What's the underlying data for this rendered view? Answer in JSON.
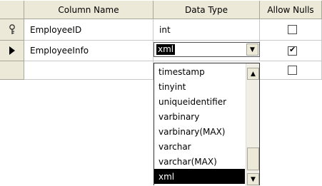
{
  "columns": {
    "name": "Column Name",
    "type": "Data Type",
    "nulls": "Allow Nulls"
  },
  "rows": [
    {
      "name": "EmployeeID",
      "type": "int",
      "allow_nulls": false,
      "key": true
    },
    {
      "name": "EmployeeInfo",
      "type": "xml",
      "allow_nulls": true,
      "current": true
    },
    {
      "name": "",
      "type": "",
      "allow_nulls": false
    }
  ],
  "dropdown": {
    "options": [
      "timestamp",
      "tinyint",
      "uniqueidentifier",
      "varbinary",
      "varbinary(MAX)",
      "varchar",
      "varchar(MAX)",
      "xml"
    ],
    "selected": "xml"
  },
  "icons": {
    "key": "key-icon",
    "current_row": "row-pointer-icon",
    "dropdown": "chevron-down-icon"
  }
}
